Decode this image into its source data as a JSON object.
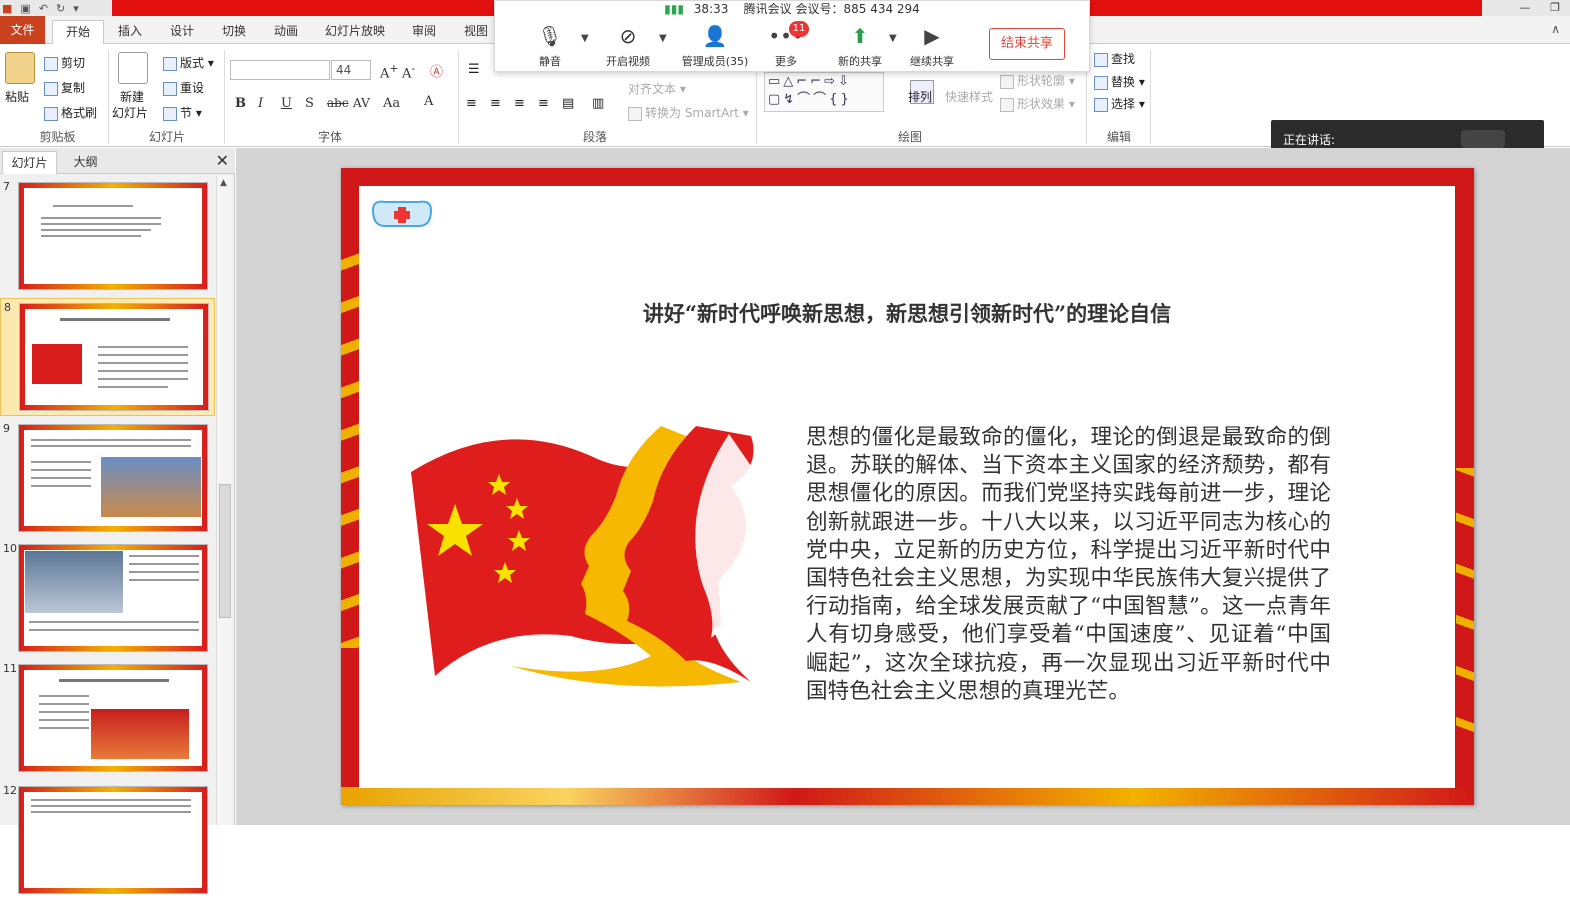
{
  "menu": {
    "file": "文件",
    "home": "开始",
    "insert": "插入",
    "design": "设计",
    "transitions": "切换",
    "animations": "动画",
    "slideshow": "幻灯片放映",
    "review": "审阅",
    "view": "视图"
  },
  "ribbon": {
    "clipboard": {
      "paste": "粘贴",
      "cut": "剪切",
      "copy": "复制",
      "format_painter": "格式刷",
      "label": "剪贴板"
    },
    "slides": {
      "new_slide_1": "新建",
      "new_slide_2": "幻灯片",
      "layout": "版式",
      "reset": "重设",
      "section": "节",
      "label": "幻灯片"
    },
    "font": {
      "size": "44",
      "label": "字体"
    },
    "paragraph": {
      "align_text": "对齐文本",
      "smartart": "转换为 SmartArt",
      "label": "段落"
    },
    "drawing": {
      "arrange": "排列",
      "quick_styles": "快速样式",
      "shape_outline": "形状轮廓",
      "shape_effects": "形状效果",
      "label": "绘图"
    },
    "editing": {
      "find": "查找",
      "replace": "替换",
      "select": "选择",
      "label": "编辑"
    }
  },
  "meeting": {
    "time": "38:33",
    "info": "腾讯会议 会议号：885 434 294",
    "mute": "静音",
    "video": "开启视频",
    "members": "管理成员(35)",
    "more": "更多",
    "more_badge": "11",
    "new_share": "新的共享",
    "continue_share": "继续共享",
    "end_share": "结束共享",
    "speaking": "正在讲话:"
  },
  "pane": {
    "tab_slides": "幻灯片",
    "tab_outline": "大纲",
    "thumb_numbers": [
      "7",
      "8",
      "9",
      "10",
      "11",
      "12"
    ]
  },
  "slide": {
    "title": "讲好“新时代呼唤新思想，新思想引领新时代”的理论自信",
    "body": "思想的僵化是最致命的僵化，理论的倒退是最致命的倒退。苏联的解体、当下资本主义国家的经济颓势，都有思想僵化的原因。而我们党坚持实践每前进一步，理论创新就跟进一步。十八大以来，以习近平同志为核心的党中央，立足新的历史方位，科学提出习近平新时代中国特色社会主义思想，为实现中华民族伟大复兴提供了行动指南，给全球发展贡献了“中国智慧”。这一点青年人有切身感受，他们享受着“中国速度”、见证着“中国崛起”，这次全球抗疫，再一次显现出习近平新时代中国特色社会主义思想的真理光芒。"
  },
  "colors": {
    "accent_red": "#d01818",
    "gold": "#f3b200",
    "file_tab": "#c9421d"
  }
}
